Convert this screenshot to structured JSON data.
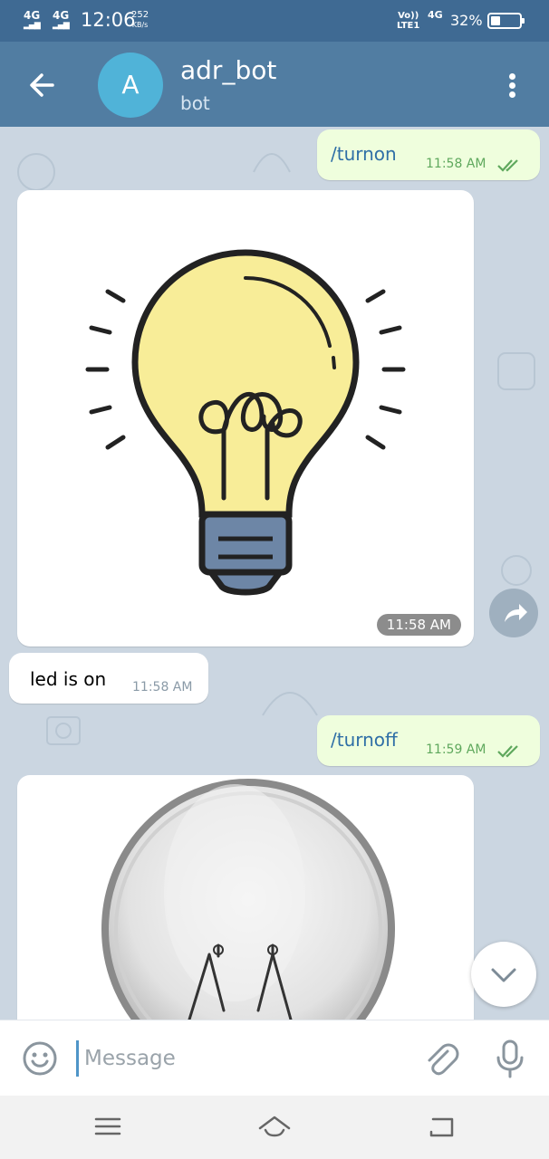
{
  "status_bar": {
    "sim1": "4G",
    "sim2": "4G",
    "time": "12:06",
    "net_speed": "252",
    "net_speed_unit": "KB/s",
    "volte_top": "Vo))",
    "volte_bottom": "LTE1",
    "data_type": "4G",
    "battery_percent": "32%",
    "battery_level": 0.32
  },
  "header": {
    "avatar_letter": "A",
    "title": "adr_bot",
    "subtitle": "bot"
  },
  "messages": [
    {
      "direction": "out",
      "text": "/turnon",
      "time": "11:58 AM",
      "status": "read"
    },
    {
      "direction": "in",
      "type": "photo",
      "photo": "lit-bulb-illustration",
      "time": "11:58 AM"
    },
    {
      "direction": "in",
      "text": "led is on",
      "time": "11:58 AM"
    },
    {
      "direction": "out",
      "text": "/turnoff",
      "time": "11:59 AM",
      "status": "read"
    },
    {
      "direction": "in",
      "type": "photo",
      "photo": "unlit-bulb-photo"
    }
  ],
  "composer": {
    "placeholder": "Message"
  },
  "icons": {
    "back": "arrow-left-icon",
    "menu": "more-vertical-icon",
    "share": "share-icon",
    "scroll_down": "chevron-down-icon",
    "emoji": "smiley-icon",
    "attach": "paperclip-icon",
    "mic": "microphone-icon",
    "nav_menu": "hamburger-icon",
    "nav_home": "home-icon",
    "nav_back": "back-icon"
  },
  "colors": {
    "header": "#517da2",
    "status_bar": "#3f6a93",
    "outgoing_bubble": "#effedd",
    "incoming_bubble": "#ffffff",
    "chat_background": "#cbd6e1",
    "read_checks": "#5fa85d"
  }
}
